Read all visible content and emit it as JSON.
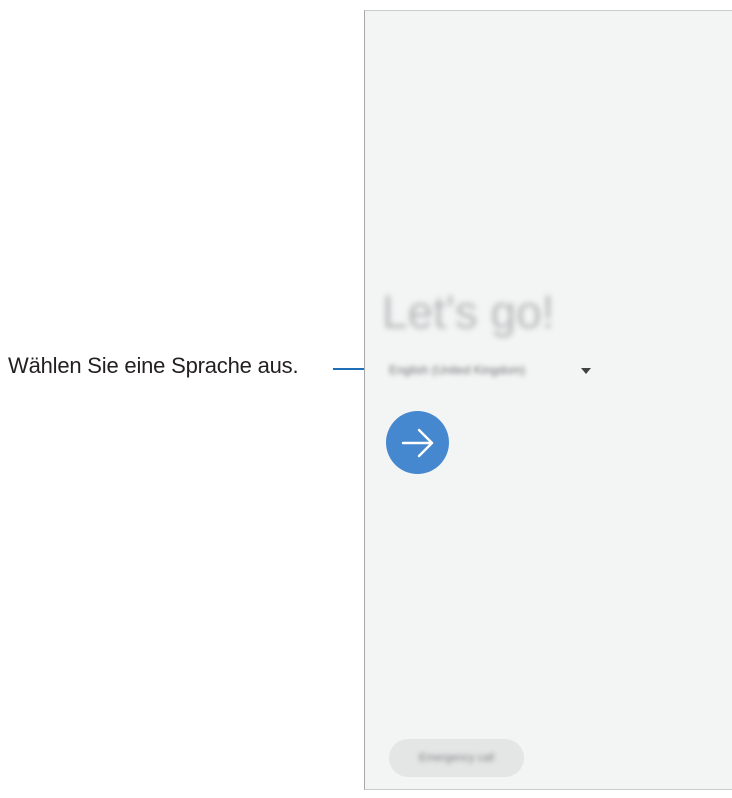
{
  "callout": {
    "label": "Wählen Sie eine Sprache aus."
  },
  "screen": {
    "headline": "Let's go!",
    "language_selected": "English (United Kingdom)",
    "next_icon": "arrow-right-icon",
    "emergency_label": "Emergency call"
  },
  "colors": {
    "accent": "#4688cf",
    "callout_line": "#1e6fb8",
    "screen_background": "#f3f4f4"
  }
}
